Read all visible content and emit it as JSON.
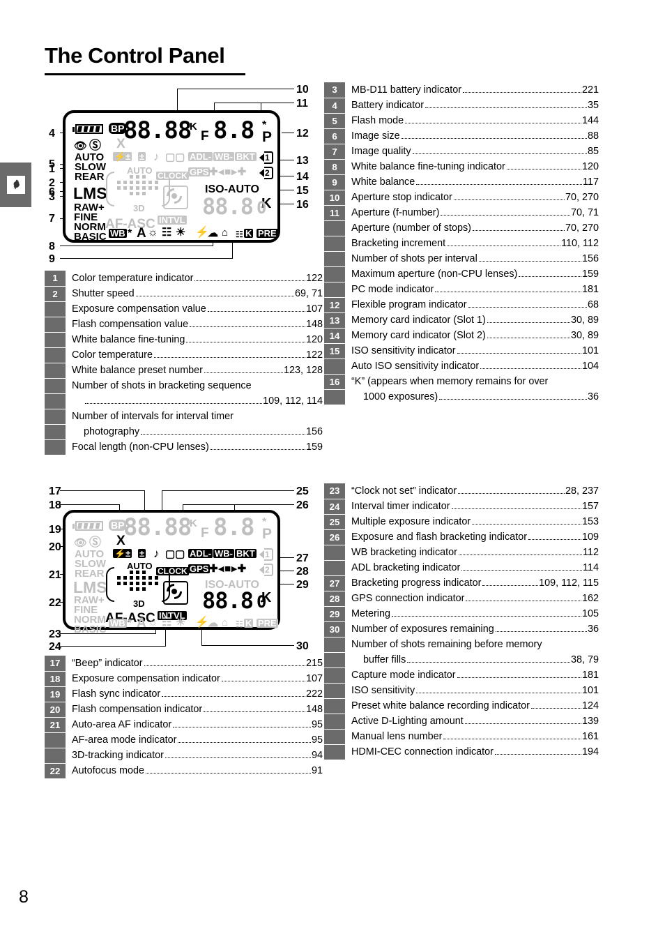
{
  "page": {
    "title": "The Control Panel",
    "number": "8",
    "chapter_tab_icon": "rooster-icon"
  },
  "figures": {
    "top": {
      "caption_ids": [
        "1",
        "2",
        "3",
        "4",
        "5",
        "6",
        "7",
        "8",
        "9",
        "10",
        "11",
        "12",
        "13",
        "14",
        "15",
        "16"
      ],
      "lcd_elements": {
        "battery": "battery-icon",
        "bp": "BP",
        "x_sync": "X",
        "shutter_digits": "88.88",
        "k_small": "K",
        "aperture_prefix": "F",
        "aperture_digits": "8.8",
        "star": "*",
        "p_mode": "P",
        "redeye": "redeye-icon",
        "flash_off": "flash-cancel-icon",
        "auto": "AUTO",
        "slow": "SLOW",
        "rear": "REAR",
        "lms": "LMS",
        "raw": "RAW+",
        "fine": "FINE",
        "norm": "NORM",
        "basic": "BASIC",
        "flash_comp": "flash-comp-icon",
        "exp_comp": "exp-comp-icon",
        "beep": "beep-icon",
        "multi_exp": "multi-exposure-icon",
        "adl": "ADL-",
        "wb_bkt": "WB-",
        "bkt": "BKT",
        "slot1": "1",
        "slot2": "2",
        "af_auto": "AUTO",
        "af_3d": "3D",
        "af_asc": "AF-ASC",
        "clock": "CLOCK",
        "gps": "GPS",
        "bracket_progress": "+ <|> +",
        "iso_auto": "ISO-AUTO",
        "k_large": "K",
        "exposures_digits": "88.8",
        "intvl": "INTVL",
        "metering": "metering-icon",
        "wb": "WB",
        "wb_star": "*",
        "wb_a": "A",
        "wb_incandescent": "incandescent-icon",
        "wb_fluorescent": "fluorescent-icon",
        "wb_sun": "direct-sunlight-icon",
        "wb_flash": "flash-icon",
        "wb_cloudy": "cloudy-icon",
        "wb_shade": "shade-icon",
        "wb_k": "K",
        "wb_pre": "PRE"
      }
    },
    "bottom": {
      "caption_ids": [
        "17",
        "18",
        "19",
        "20",
        "21",
        "22",
        "23",
        "24",
        "25",
        "26",
        "27",
        "28",
        "29",
        "30"
      ]
    }
  },
  "lists": {
    "top_left": [
      {
        "num": "1",
        "text": "Color temperature indicator",
        "page": "122",
        "indent": false
      },
      {
        "num": "2",
        "text": "Shutter speed",
        "page": "69, 71",
        "indent": false
      },
      {
        "num": "",
        "text": "Exposure compensation value",
        "page": "107",
        "indent": false
      },
      {
        "num": "",
        "text": "Flash compensation value",
        "page": "148",
        "indent": false
      },
      {
        "num": "",
        "text": "White balance fine-tuning",
        "page": "120",
        "indent": false
      },
      {
        "num": "",
        "text": "Color temperature",
        "page": "122",
        "indent": false
      },
      {
        "num": "",
        "text": "White balance preset number",
        "page": "123, 128",
        "indent": false
      },
      {
        "num": "",
        "text": "Number of shots in bracketing sequence",
        "page": "",
        "indent": false,
        "noleader": true
      },
      {
        "num": "",
        "text": "",
        "page": "109, 112, 114",
        "indent": true
      },
      {
        "num": "",
        "text": "Number of intervals for interval timer",
        "page": "",
        "indent": false,
        "noleader": true
      },
      {
        "num": "",
        "text": "photography",
        "page": "156",
        "indent": true
      },
      {
        "num": "",
        "text": "Focal length (non-CPU lenses)",
        "page": "159",
        "indent": false
      }
    ],
    "top_right": [
      {
        "num": "3",
        "text": "MB-D11 battery indicator",
        "page": "221",
        "indent": false
      },
      {
        "num": "4",
        "text": "Battery indicator",
        "page": "35",
        "indent": false
      },
      {
        "num": "5",
        "text": "Flash mode",
        "page": "144",
        "indent": false
      },
      {
        "num": "6",
        "text": "Image size",
        "page": "88",
        "indent": false
      },
      {
        "num": "7",
        "text": "Image quality",
        "page": "85",
        "indent": false
      },
      {
        "num": "8",
        "text": "White balance fine-tuning indicator",
        "page": "120",
        "indent": false
      },
      {
        "num": "9",
        "text": "White balance",
        "page": "117",
        "indent": false
      },
      {
        "num": "10",
        "text": "Aperture stop indicator",
        "page": "70, 270",
        "indent": false
      },
      {
        "num": "11",
        "text": "Aperture (f-number)",
        "page": "70, 71",
        "indent": false
      },
      {
        "num": "",
        "text": "Aperture (number of stops)",
        "page": "70, 270",
        "indent": false
      },
      {
        "num": "",
        "text": "Bracketing increment",
        "page": "110, 112",
        "indent": false
      },
      {
        "num": "",
        "text": "Number of shots per interval",
        "page": "156",
        "indent": false
      },
      {
        "num": "",
        "text": "Maximum aperture (non-CPU lenses)",
        "page": "159",
        "indent": false
      },
      {
        "num": "",
        "text": "PC mode indicator",
        "page": "181",
        "indent": false
      },
      {
        "num": "12",
        "text": "Flexible program indicator",
        "page": "68",
        "indent": false
      },
      {
        "num": "13",
        "text": "Memory card indicator (Slot 1)",
        "page": "30, 89",
        "indent": false
      },
      {
        "num": "14",
        "text": "Memory card indicator (Slot 2)",
        "page": "30, 89",
        "indent": false
      },
      {
        "num": "15",
        "text": "ISO sensitivity indicator",
        "page": "101",
        "indent": false
      },
      {
        "num": "",
        "text": "Auto ISO sensitivity indicator",
        "page": "104",
        "indent": false
      },
      {
        "num": "16",
        "text": "“K” (appears when memory remains for over",
        "page": "",
        "indent": false,
        "noleader": true
      },
      {
        "num": "",
        "text": "1000 exposures)",
        "page": "36",
        "indent": true
      }
    ],
    "bottom_left": [
      {
        "num": "17",
        "text": "“Beep” indicator",
        "page": "215",
        "indent": false
      },
      {
        "num": "18",
        "text": "Exposure compensation indicator",
        "page": "107",
        "indent": false
      },
      {
        "num": "19",
        "text": "Flash sync indicator",
        "page": "222",
        "indent": false
      },
      {
        "num": "20",
        "text": "Flash compensation indicator",
        "page": "148",
        "indent": false
      },
      {
        "num": "21",
        "text": "Auto-area AF indicator",
        "page": "95",
        "indent": false
      },
      {
        "num": "",
        "text": "AF-area mode indicator",
        "page": "95",
        "indent": false
      },
      {
        "num": "",
        "text": "3D-tracking indicator",
        "page": "94",
        "indent": false
      },
      {
        "num": "22",
        "text": "Autofocus mode",
        "page": "91",
        "indent": false
      }
    ],
    "bottom_right": [
      {
        "num": "23",
        "text": "“Clock not set” indicator",
        "page": "28, 237",
        "indent": false
      },
      {
        "num": "24",
        "text": "Interval timer indicator",
        "page": "157",
        "indent": false
      },
      {
        "num": "25",
        "text": "Multiple exposure indicator",
        "page": "153",
        "indent": false
      },
      {
        "num": "26",
        "text": "Exposure and flash bracketing indicator",
        "page": "109",
        "indent": false
      },
      {
        "num": "",
        "text": "WB bracketing indicator",
        "page": "112",
        "indent": false
      },
      {
        "num": "",
        "text": "ADL bracketing indicator",
        "page": "114",
        "indent": false
      },
      {
        "num": "27",
        "text": "Bracketing progress indicator",
        "page": "109, 112, 115",
        "indent": false
      },
      {
        "num": "28",
        "text": "GPS connection indicator",
        "page": "162",
        "indent": false
      },
      {
        "num": "29",
        "text": "Metering",
        "page": "105",
        "indent": false
      },
      {
        "num": "30",
        "text": "Number of exposures remaining",
        "page": "36",
        "indent": false
      },
      {
        "num": "",
        "text": "Number of shots remaining before memory",
        "page": "",
        "indent": false,
        "noleader": true
      },
      {
        "num": "",
        "text": "buffer fills",
        "page": "38, 79",
        "indent": true
      },
      {
        "num": "",
        "text": "Capture mode indicator",
        "page": "181",
        "indent": false
      },
      {
        "num": "",
        "text": "ISO sensitivity",
        "page": "101",
        "indent": false
      },
      {
        "num": "",
        "text": "Preset white balance recording indicator",
        "page": "124",
        "indent": false
      },
      {
        "num": "",
        "text": "Active D-Lighting amount",
        "page": "139",
        "indent": false
      },
      {
        "num": "",
        "text": "Manual lens number",
        "page": "161",
        "indent": false
      },
      {
        "num": "",
        "text": "HDMI-CEC connection indicator",
        "page": "194",
        "indent": false
      }
    ]
  },
  "colors": {
    "gutter_gray": "#6b6b6b",
    "lcd_off_gray": "#bfbfbf",
    "lcd_on_black": "#000000"
  }
}
